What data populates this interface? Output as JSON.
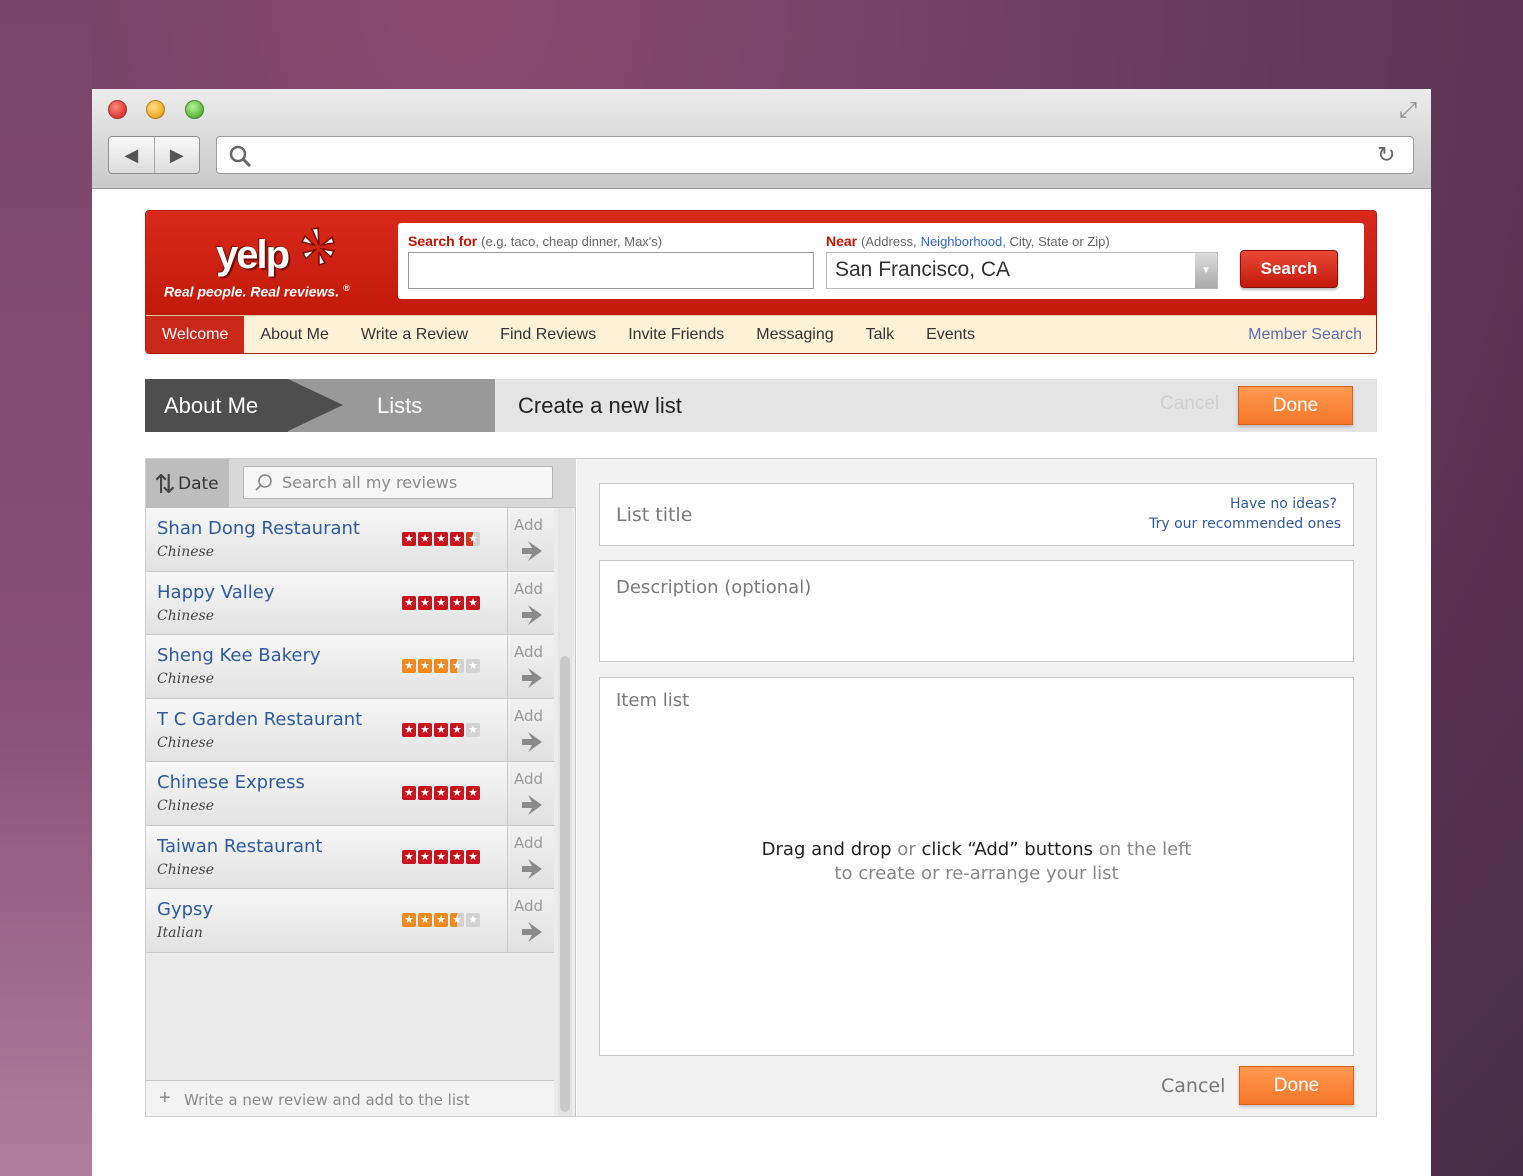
{
  "browser": {
    "url": "",
    "controls": {
      "back": "◀",
      "forward": "▶"
    }
  },
  "yelp": {
    "logo_text": "yelp",
    "tagline": "Real people. Real reviews.",
    "tagline_mark": "®",
    "search_for_label": "Search for",
    "search_for_hint": "(e.g. taco, cheap dinner, Max's)",
    "search_for_value": "",
    "near_label": "Near",
    "near_hint_1": "(Address,",
    "near_hint_link": "Neighborhood",
    "near_hint_2": ", City, State or Zip)",
    "near_value": "San Francisco, CA",
    "search_button": "Search",
    "nav": [
      {
        "label": "Welcome",
        "active": true
      },
      {
        "label": "About Me",
        "active": false
      },
      {
        "label": "Write a Review",
        "active": false
      },
      {
        "label": "Find Reviews",
        "active": false
      },
      {
        "label": "Invite Friends",
        "active": false
      },
      {
        "label": "Messaging",
        "active": false
      },
      {
        "label": "Talk",
        "active": false
      },
      {
        "label": "Events",
        "active": false
      }
    ],
    "member_search": "Member Search"
  },
  "breadcrumb": {
    "about": "About Me",
    "lists": "Lists",
    "current": "Create a new list",
    "cancel": "Cancel",
    "done": "Done"
  },
  "left": {
    "sort_label": "Date",
    "search_placeholder": "Search all my reviews",
    "add_label": "Add",
    "reviews": [
      {
        "name": "Shan Dong Restaurant",
        "category": "Chinese",
        "rating": 4.5,
        "color": "red"
      },
      {
        "name": "Happy Valley",
        "category": "Chinese",
        "rating": 5,
        "color": "red"
      },
      {
        "name": "Sheng Kee Bakery",
        "category": "Chinese",
        "rating": 3.5,
        "color": "orange"
      },
      {
        "name": "T C Garden Restaurant",
        "category": "Chinese",
        "rating": 4,
        "color": "red"
      },
      {
        "name": "Chinese Express",
        "category": "Chinese",
        "rating": 5,
        "color": "red"
      },
      {
        "name": "Taiwan Restaurant",
        "category": "Chinese",
        "rating": 5,
        "color": "red"
      },
      {
        "name": "Gypsy",
        "category": "Italian",
        "rating": 3.5,
        "color": "orange"
      }
    ],
    "write_new": "Write a new review and add to the list"
  },
  "right": {
    "list_title_placeholder": "List title",
    "ideas_line1": "Have no ideas?",
    "ideas_line2": "Try our recommended ones",
    "description_placeholder": "Description (optional)",
    "item_list_label": "Item list",
    "hint_a": "Drag and drop",
    "hint_b": " or ",
    "hint_c": "click “Add” buttons",
    "hint_d": " on the left",
    "hint_line2": "to create or re-arrange your list",
    "cancel": "Cancel",
    "done": "Done"
  }
}
